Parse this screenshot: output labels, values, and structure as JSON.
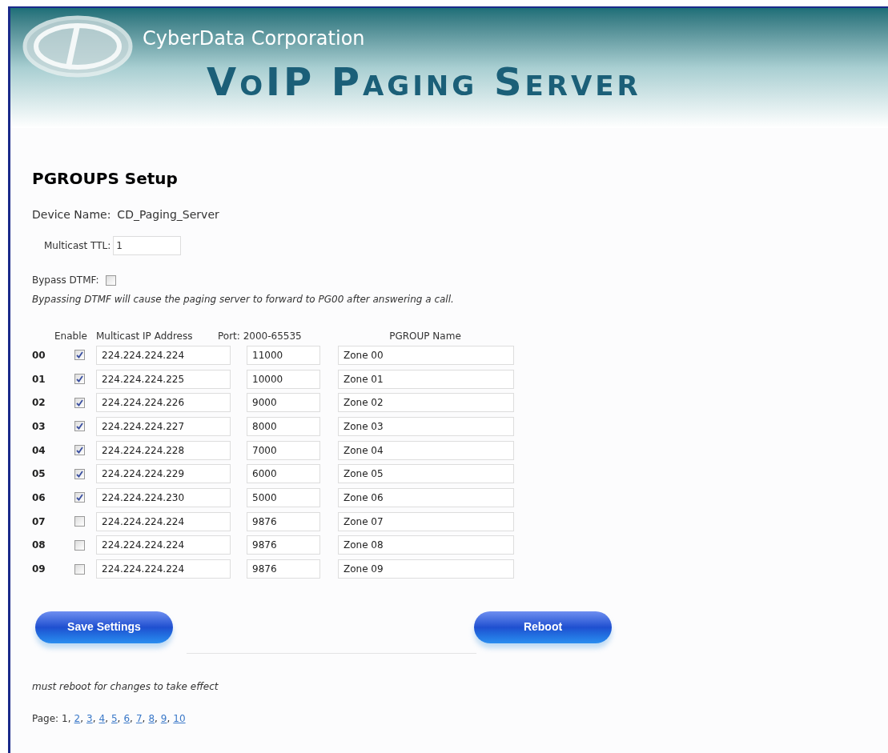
{
  "header": {
    "company": "CyberData Corporation",
    "product": "VoIP Paging Server"
  },
  "title": "PGROUPS Setup",
  "device": {
    "label": "Device Name:",
    "value": "CD_Paging_Server"
  },
  "ttl": {
    "label": "Multicast TTL:",
    "value": "1"
  },
  "bypass": {
    "label": "Bypass DTMF:",
    "checked": false,
    "note": "Bypassing DTMF will cause the paging server to forward to PG00 after answering a call."
  },
  "columns": [
    "Enable",
    "Multicast IP Address",
    "Port: 2000-65535",
    "PGROUP Name"
  ],
  "rows": [
    {
      "index": "00",
      "enabled": true,
      "ip": "224.224.224.224",
      "port": "11000",
      "name": "Zone 00"
    },
    {
      "index": "01",
      "enabled": true,
      "ip": "224.224.224.225",
      "port": "10000",
      "name": "Zone 01"
    },
    {
      "index": "02",
      "enabled": true,
      "ip": "224.224.224.226",
      "port": "9000",
      "name": "Zone 02"
    },
    {
      "index": "03",
      "enabled": true,
      "ip": "224.224.224.227",
      "port": "8000",
      "name": "Zone 03"
    },
    {
      "index": "04",
      "enabled": true,
      "ip": "224.224.224.228",
      "port": "7000",
      "name": "Zone 04"
    },
    {
      "index": "05",
      "enabled": true,
      "ip": "224.224.224.229",
      "port": "6000",
      "name": "Zone 05"
    },
    {
      "index": "06",
      "enabled": true,
      "ip": "224.224.224.230",
      "port": "5000",
      "name": "Zone 06"
    },
    {
      "index": "07",
      "enabled": false,
      "ip": "224.224.224.224",
      "port": "9876",
      "name": "Zone 07"
    },
    {
      "index": "08",
      "enabled": false,
      "ip": "224.224.224.224",
      "port": "9876",
      "name": "Zone 08"
    },
    {
      "index": "09",
      "enabled": false,
      "ip": "224.224.224.224",
      "port": "9876",
      "name": "Zone 09"
    }
  ],
  "buttons": [
    "Save Settings",
    "Reboot"
  ],
  "reboot_note": "must reboot for changes to take effect",
  "pagination": {
    "label": "Page:",
    "separator": ",",
    "pages": [
      {
        "label": "1",
        "selected": true
      },
      {
        "label": "2",
        "selected": false
      },
      {
        "label": "3",
        "selected": false
      },
      {
        "label": "4",
        "selected": false
      },
      {
        "label": "5",
        "selected": false
      },
      {
        "label": "6",
        "selected": false
      },
      {
        "label": "7",
        "selected": false
      },
      {
        "label": "8",
        "selected": false
      },
      {
        "label": "9",
        "selected": false
      },
      {
        "label": "10",
        "selected": false
      }
    ]
  }
}
